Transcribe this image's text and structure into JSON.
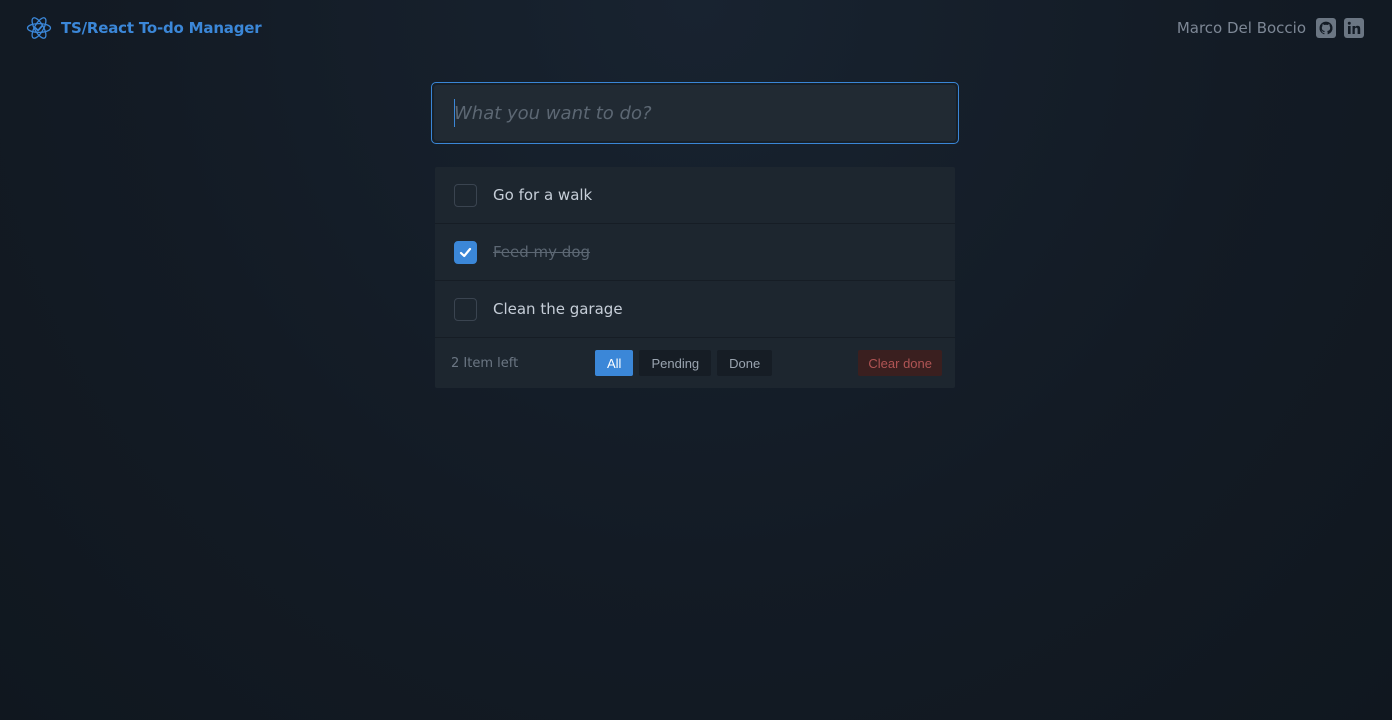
{
  "header": {
    "title": "TS/React To-do Manager",
    "logo_icon": "react-atom-icon",
    "author": "Marco Del Boccio",
    "social": [
      {
        "icon": "github-icon"
      },
      {
        "icon": "linkedin-icon"
      }
    ]
  },
  "input": {
    "placeholder": "What you want to do?",
    "value": ""
  },
  "todos": [
    {
      "label": "Go for a walk",
      "done": false
    },
    {
      "label": "Feed my dog",
      "done": true
    },
    {
      "label": "Clean the garage",
      "done": false
    }
  ],
  "footer": {
    "items_left": "2 Item left",
    "filters": [
      {
        "label": "All",
        "active": true
      },
      {
        "label": "Pending",
        "active": false
      },
      {
        "label": "Done",
        "active": false
      }
    ],
    "clear_label": "Clear done"
  },
  "colors": {
    "accent": "#3b87d8",
    "danger": "#b05454",
    "background": "#131b25"
  }
}
